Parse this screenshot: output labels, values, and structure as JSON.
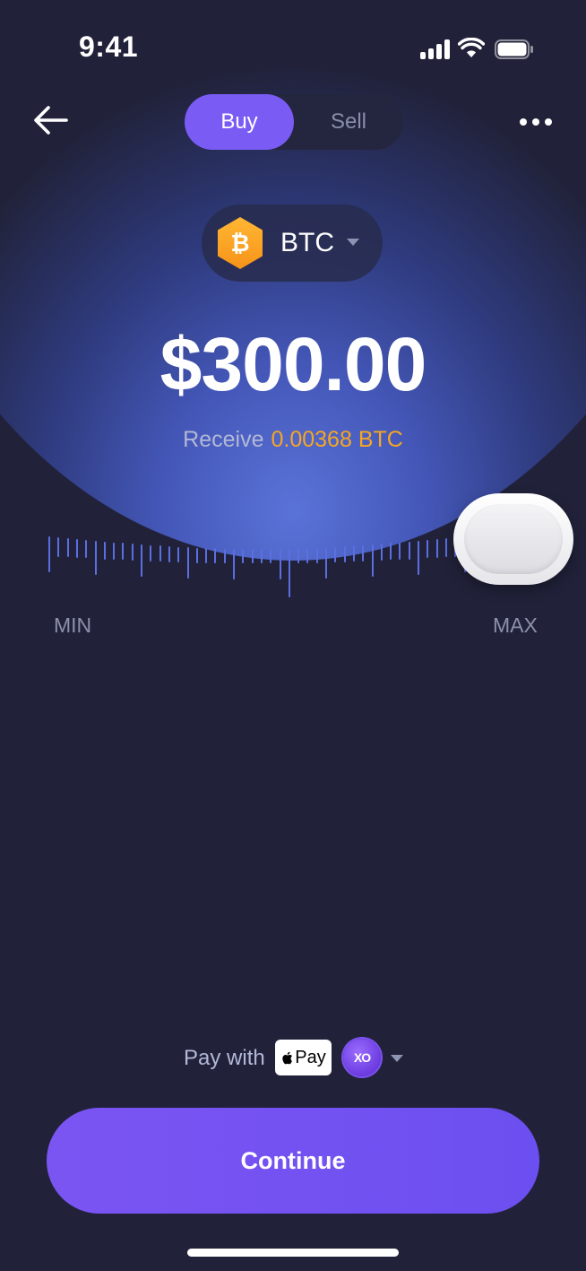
{
  "status_bar": {
    "time": "9:41"
  },
  "nav": {
    "tabs": [
      {
        "label": "Buy",
        "active": true
      },
      {
        "label": "Sell",
        "active": false
      }
    ]
  },
  "asset": {
    "symbol": "BTC",
    "icon": "bitcoin-icon"
  },
  "amount": {
    "display": "$300.00"
  },
  "receive": {
    "label": "Receive",
    "value": "0.00368 BTC"
  },
  "slider": {
    "min_label": "MIN",
    "max_label": "MAX"
  },
  "pay": {
    "label": "Pay with",
    "apple_pay_label": "Pay",
    "provider_label": "XO"
  },
  "cta": {
    "label": "Continue"
  },
  "colors": {
    "accent": "#7a5cf5",
    "btc": "#f7931a",
    "receive_value": "#f5a623",
    "background": "#21223a"
  }
}
